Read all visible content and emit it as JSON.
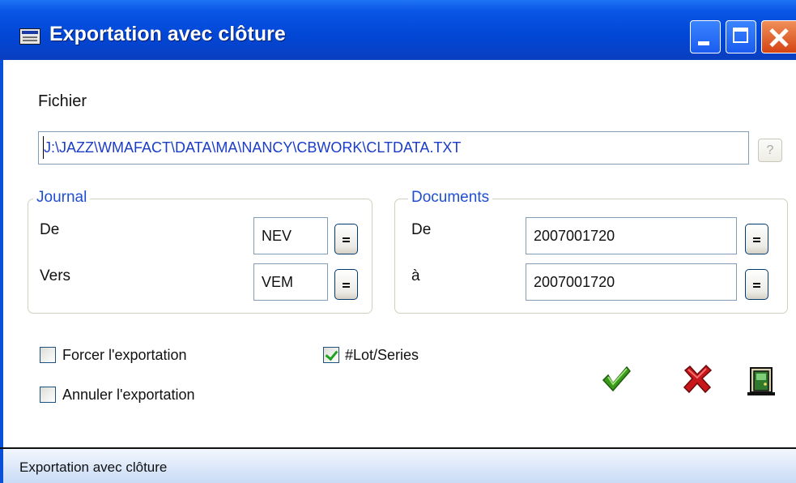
{
  "window": {
    "title": "Exportation avec clôture",
    "icon": "form-window-icon"
  },
  "fichier": {
    "label": "Fichier",
    "value": "J:\\JAZZ\\WMAFACT\\DATA\\MA\\NANCY\\CBWORK\\CLTDATA.TXT",
    "browse_label": "?"
  },
  "journal": {
    "legend": "Journal",
    "from_label": "De",
    "from_value": "NEV",
    "to_label": "Vers",
    "to_value": "VEM"
  },
  "documents": {
    "legend": "Documents",
    "from_label": "De",
    "from_value": "2007001720",
    "to_label": "à",
    "to_value": "2007001720"
  },
  "options": {
    "forcer_label": "Forcer l'exportation",
    "forcer_checked": false,
    "annuler_label": "Annuler l'exportation",
    "annuler_checked": false,
    "lot_label": "#Lot/Series",
    "lot_checked": true
  },
  "actions": {
    "ok_icon": "green-check-icon",
    "cancel_icon": "red-x-icon",
    "exit_icon": "exit-door-icon"
  },
  "status": {
    "text": "Exportation avec clôture"
  },
  "colors": {
    "titlebar": "#0146d5",
    "legend": "#1f4ed0",
    "path_text": "#1a3cc8",
    "ok": "#3a9a1a",
    "cancel": "#c8161a"
  }
}
